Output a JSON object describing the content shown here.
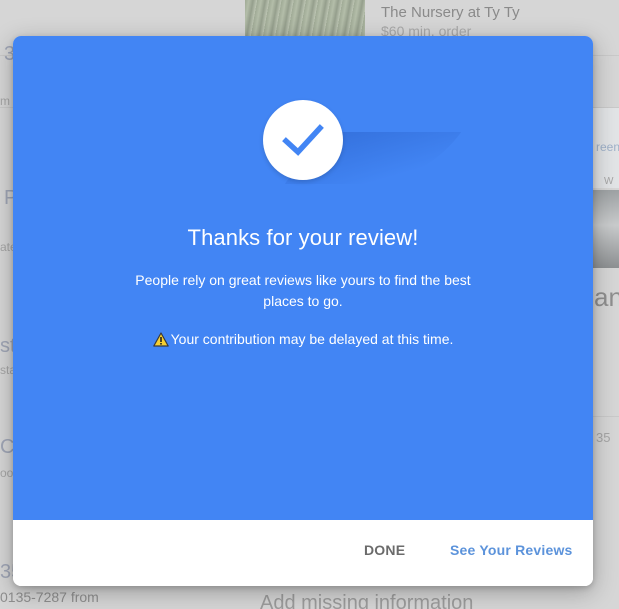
{
  "background": {
    "listing_title": "The Nursery at Ty Ty",
    "listing_subtitle": "$60 min. order",
    "footer_text": "Add missing information",
    "left_phone": "0135-7287 from",
    "left_fragments": [
      "3",
      "m",
      "P",
      "ate",
      "st",
      "sta",
      "C",
      "oo",
      "35"
    ],
    "right_fragments": [
      "reen",
      "W",
      "an",
      "35"
    ]
  },
  "modal": {
    "icon": "checkmark-icon",
    "title": "Thanks for your review!",
    "body": "People rely on great reviews like yours to find the best places to go.",
    "warning_icon": "warning-icon",
    "warning_text": "Your contribution may be delayed at this time.",
    "actions": {
      "done_label": "DONE",
      "reviews_label": "See Your Reviews"
    }
  },
  "colors": {
    "dialog_blue": "#4285f4",
    "check_blue": "#4285f4",
    "link_blue": "#5c93db",
    "done_gray": "#6b6b6b"
  }
}
